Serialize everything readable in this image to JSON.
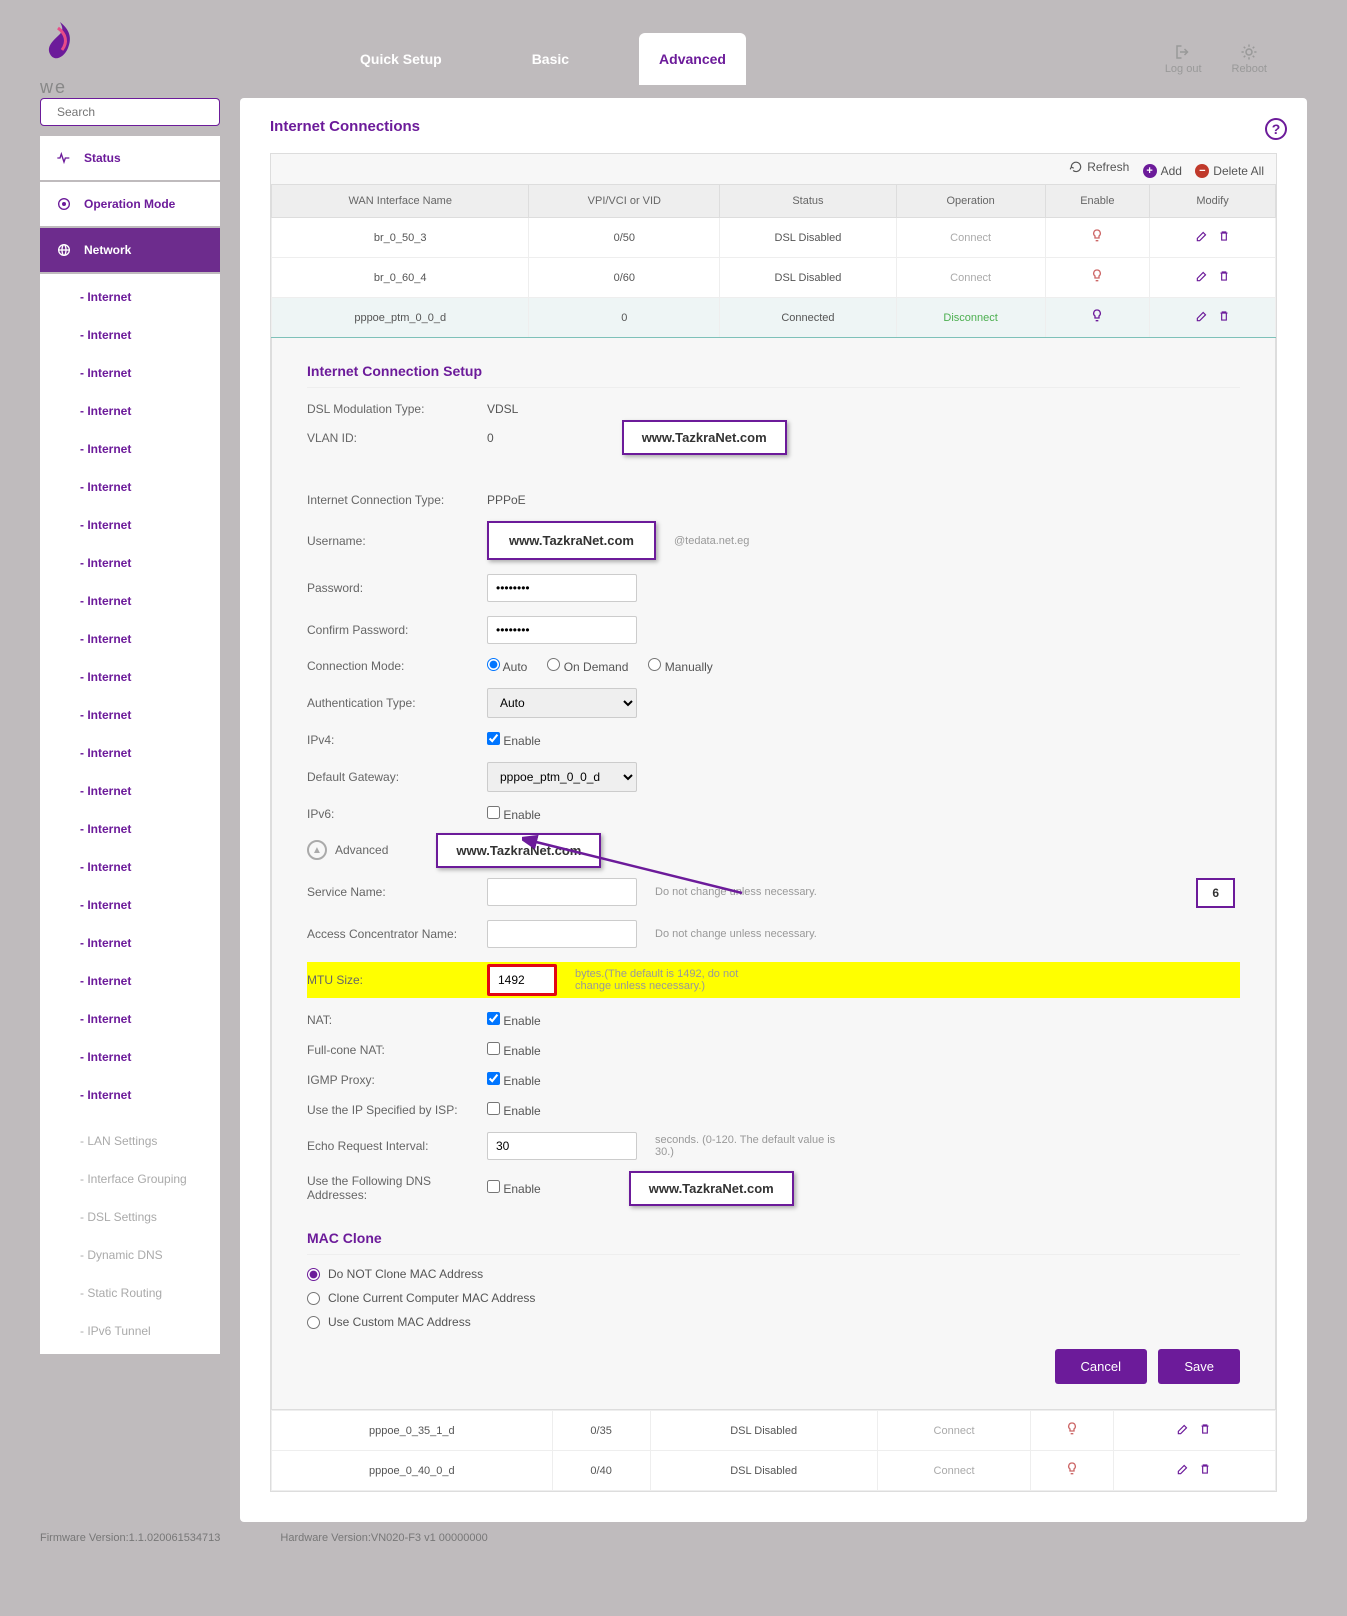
{
  "watermark": "www.TazkraNet.com",
  "annotation_label": "6",
  "top_nav": {
    "quick_setup": "Quick Setup",
    "basic": "Basic",
    "advanced": "Advanced"
  },
  "top_actions": {
    "logout": "Log out",
    "reboot": "Reboot"
  },
  "search_placeholder": "Search",
  "sidebar": {
    "status": "Status",
    "operation_mode": "Operation Mode",
    "network": "Network",
    "internet_label": "- Internet",
    "lan": "- LAN Settings",
    "interface_grouping": "- Interface Grouping",
    "dsl": "- DSL Settings",
    "ddns": "- Dynamic DNS",
    "static_routing": "- Static Routing",
    "ipv6_tunnel": "- IPv6 Tunnel"
  },
  "page": {
    "title": "Internet Connections",
    "refresh": "Refresh",
    "add": "Add",
    "delete_all": "Delete All"
  },
  "table": {
    "headers": {
      "wan": "WAN Interface Name",
      "vpi": "VPI/VCI or VID",
      "status": "Status",
      "operation": "Operation",
      "enable": "Enable",
      "modify": "Modify"
    },
    "rows": [
      {
        "name": "br_0_50_3",
        "vpi": "0/50",
        "status": "DSL Disabled",
        "op": "Connect",
        "active": false
      },
      {
        "name": "br_0_60_4",
        "vpi": "0/60",
        "status": "DSL Disabled",
        "op": "Connect",
        "active": false
      },
      {
        "name": "pppoe_ptm_0_0_d",
        "vpi": "0",
        "status": "Connected",
        "op": "Disconnect",
        "active": true
      }
    ],
    "bottom_rows": [
      {
        "name": "pppoe_0_35_1_d",
        "vpi": "0/35",
        "status": "DSL Disabled",
        "op": "Connect"
      },
      {
        "name": "pppoe_0_40_0_d",
        "vpi": "0/40",
        "status": "DSL Disabled",
        "op": "Connect"
      }
    ]
  },
  "setup": {
    "title": "Internet Connection Setup",
    "dsl_mod_label": "DSL Modulation Type:",
    "dsl_mod_value": "VDSL",
    "vlan_label": "VLAN ID:",
    "vlan_value": "0",
    "conn_type_label": "Internet Connection Type:",
    "conn_type_value": "PPPoE",
    "username_label": "Username:",
    "username_suffix": "@tedata.net.eg",
    "password_label": "Password:",
    "password_value": "********",
    "confirm_label": "Confirm Password:",
    "confirm_value": "********",
    "conn_mode_label": "Connection Mode:",
    "conn_auto": "Auto",
    "conn_ondemand": "On Demand",
    "conn_manual": "Manually",
    "auth_label": "Authentication Type:",
    "auth_value": "Auto",
    "ipv4_label": "IPv4:",
    "enable_text": "Enable",
    "dgw_label": "Default Gateway:",
    "dgw_value": "pppoe_ptm_0_0_d",
    "ipv6_label": "IPv6:",
    "advanced_toggle": "Advanced",
    "service_name_label": "Service Name:",
    "service_hint": "Do not change unless necessary.",
    "ac_name_label": "Access Concentrator Name:",
    "mtu_label": "MTU Size:",
    "mtu_value": "1492",
    "mtu_hint": "bytes.(The default is 1492, do not change unless necessary.)",
    "nat_label": "NAT:",
    "fullcone_label": "Full-cone NAT:",
    "igmp_label": "IGMP Proxy:",
    "isp_ip_label": "Use the IP Specified by ISP:",
    "echo_label": "Echo Request Interval:",
    "echo_value": "30",
    "echo_hint": "seconds. (0-120. The default value is 30.)",
    "dns_label": "Use the Following DNS Addresses:"
  },
  "mac_clone": {
    "title": "MAC Clone",
    "opt1": "Do NOT Clone MAC Address",
    "opt2": "Clone Current Computer MAC Address",
    "opt3": "Use Custom MAC Address"
  },
  "buttons": {
    "cancel": "Cancel",
    "save": "Save"
  },
  "footer": {
    "fw": "Firmware Version:1.1.020061534713",
    "hw": "Hardware Version:VN020-F3 v1 00000000"
  }
}
